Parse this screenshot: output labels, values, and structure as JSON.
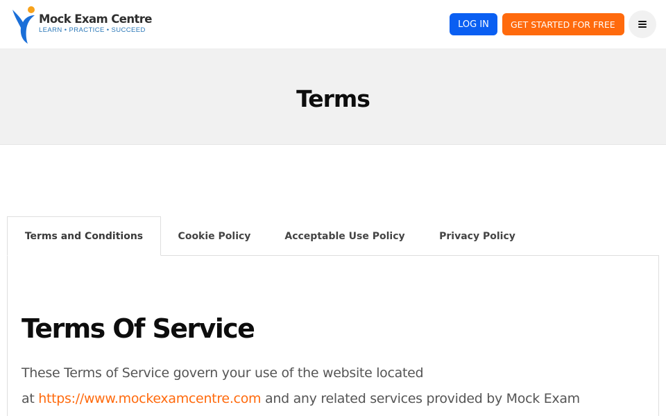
{
  "header": {
    "logo": {
      "title": "Mock Exam Centre",
      "tagline": "LEARN • PRACTICE • SUCCEED"
    },
    "login_label": "LOG IN",
    "get_started_label": "GET STARTED FOR FREE",
    "menu_icon": "hamburger-icon"
  },
  "hero": {
    "title": "Terms"
  },
  "tabs": [
    {
      "label": "Terms and Conditions",
      "active": true
    },
    {
      "label": "Cookie Policy",
      "active": false
    },
    {
      "label": "Acceptable Use Policy",
      "active": false
    },
    {
      "label": "Privacy Policy",
      "active": false
    }
  ],
  "content": {
    "title": "Terms Of Service",
    "para_line1": "These Terms of Service govern your use of the website located",
    "para_at": "at ",
    "para_link": "https://www.mockexamcentre.com",
    "para_rest": " and any related services provided by Mock Exam"
  },
  "colors": {
    "primary_blue": "#0a5ff2",
    "accent_orange": "#ff6a0d",
    "hero_bg": "#f1f1f1"
  }
}
